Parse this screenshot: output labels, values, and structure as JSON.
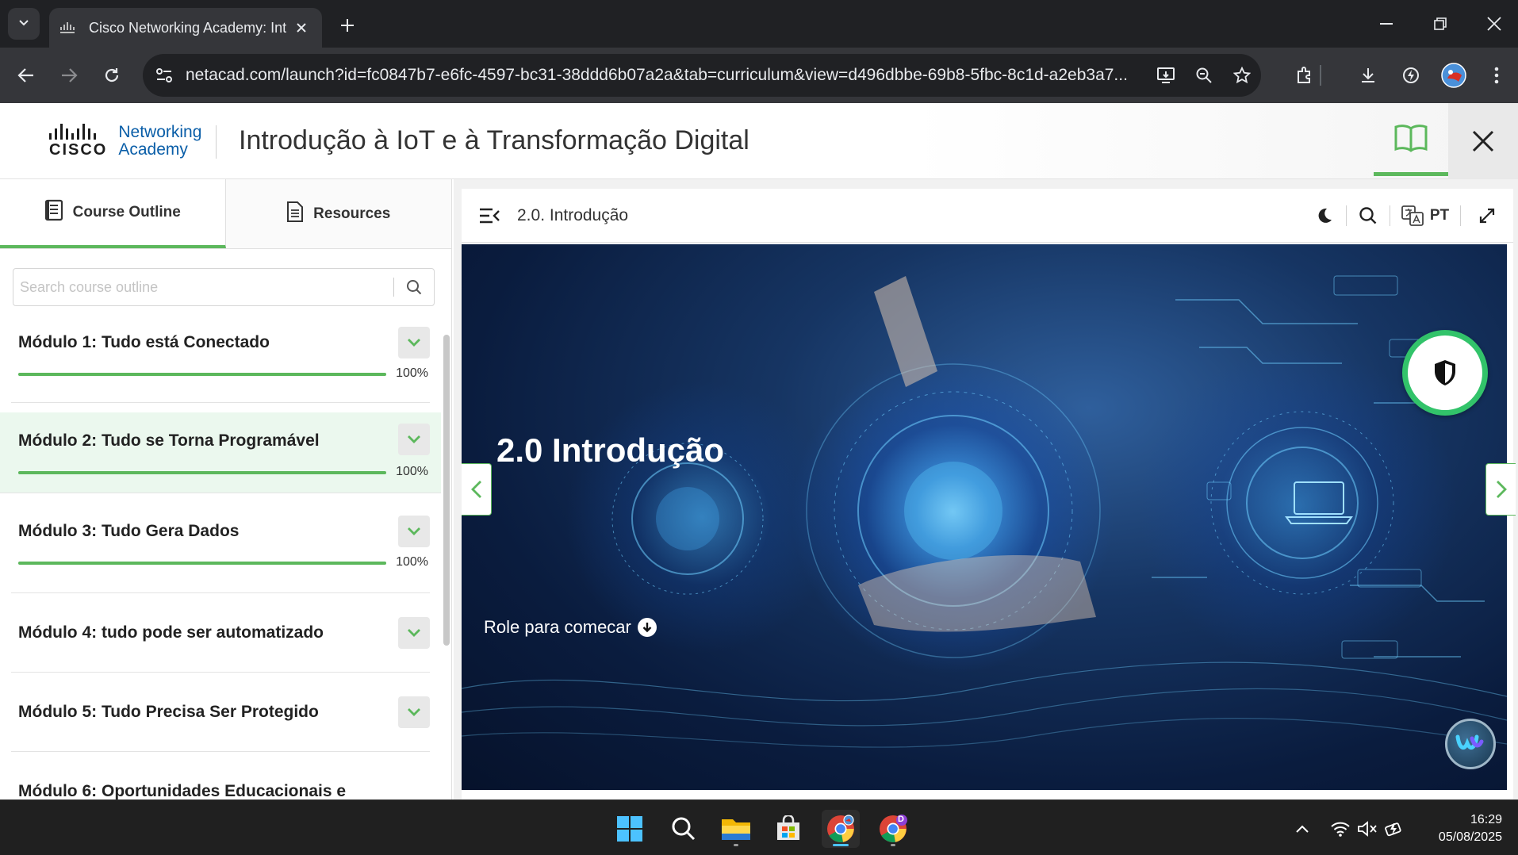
{
  "browser": {
    "tab_title": "Cisco Networking Academy: Int",
    "url": "netacad.com/launch?id=fc0847b7-e6fc-4597-bc31-38ddd6b07a2a&tab=curriculum&view=d496dbbe-69b8-5fbc-8c1d-a2eb3a7..."
  },
  "header": {
    "logo_brand": "CISCO",
    "logo_line1": "Networking",
    "logo_line2": "Academy",
    "course_title": "Introdução à IoT e à Transformação Digital"
  },
  "sidebar": {
    "tabs": [
      {
        "label": "Course Outline",
        "icon": "document-icon",
        "active": true
      },
      {
        "label": "Resources",
        "icon": "file-lines-icon",
        "active": false
      }
    ],
    "search_placeholder": "Search course outline",
    "modules": [
      {
        "title": "Módulo 1: Tudo está Conectado",
        "progress_label": "100%",
        "progress": 1.0,
        "selected": false
      },
      {
        "title": "Módulo 2: Tudo se Torna Programável",
        "progress_label": "100%",
        "progress": 1.0,
        "selected": true
      },
      {
        "title": "Módulo 3: Tudo Gera Dados",
        "progress_label": "100%",
        "progress": 1.0,
        "selected": false
      },
      {
        "title": "Módulo 4: tudo pode ser automatizado",
        "progress_label": "",
        "progress": null,
        "selected": false
      },
      {
        "title": "Módulo 5: Tudo Precisa Ser Protegido",
        "progress_label": "",
        "progress": null,
        "selected": false
      },
      {
        "title": "Módulo 6: Oportunidades Educacionais e",
        "progress_label": "",
        "progress": null,
        "selected": false
      }
    ]
  },
  "content": {
    "lesson_title": "2.0. Introdução",
    "language": "PT",
    "hero_title": "2.0 Introdução",
    "hero_cta": "Role para comecar"
  },
  "taskbar": {
    "time": "16:29",
    "date": "05/08/2025",
    "profile_badge": "D"
  },
  "colors": {
    "accent_green": "#5cb85c",
    "cisco_blue": "#0a5ea8",
    "shield_ring": "#32c36a",
    "chrome_dark": "#202124",
    "chrome_toolbar": "#35363a"
  }
}
